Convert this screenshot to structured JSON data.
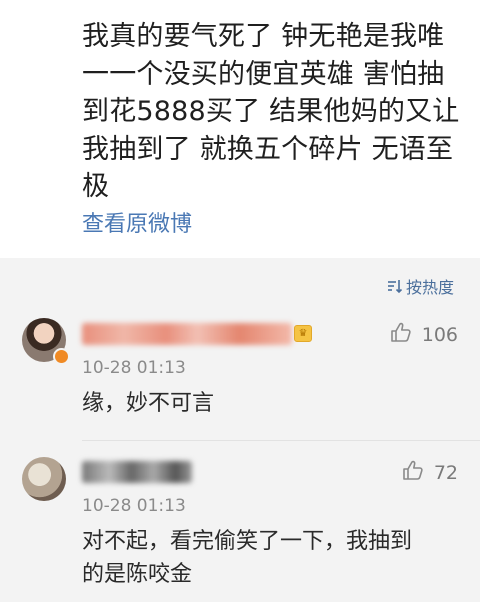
{
  "post": {
    "text": "我真的要气死了 钟无艳是我唯\n一一个没买的便宜英雄 害怕抽\n到花5888买了 结果他妈的又让\n我抽到了 就换五个碎片 无语至\n极",
    "view_original": "查看原微博"
  },
  "comments_header": {
    "sort_label": "按热度"
  },
  "comments": [
    {
      "timestamp": "10-28 01:13",
      "likes": "106",
      "text": "缘，妙不可言"
    },
    {
      "timestamp": "10-28 01:13",
      "likes": "72",
      "text": "对不起，看完偷笑了一下，我抽到\n的是陈咬金"
    }
  ],
  "colors": {
    "link": "#4a78b4",
    "comments_bg": "#f3f3f3"
  }
}
